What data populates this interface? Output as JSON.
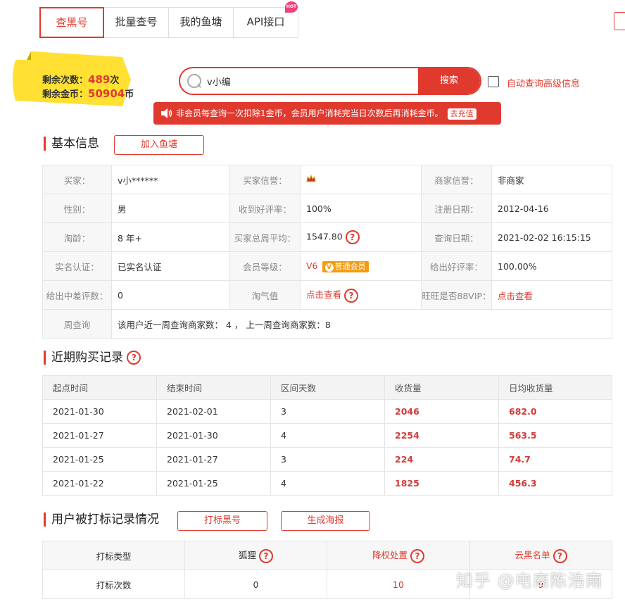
{
  "tabs": [
    {
      "label": "查黑号"
    },
    {
      "label": "批量查号"
    },
    {
      "label": "我的鱼塘"
    },
    {
      "label": "API接口",
      "badge": "HOT"
    }
  ],
  "balance": {
    "times_label": "剩余次数：",
    "times_value": "489",
    "times_unit": "次",
    "coins_label": "剩余金币：",
    "coins_value": "50904",
    "coins_unit": "币"
  },
  "search": {
    "value": "v小编",
    "button": "搜索",
    "advanced_label": "自动查询高级信息"
  },
  "notice": {
    "text": "非会员每查询一次扣除1金币，会员用户消耗完当日次数后再消耗金币。",
    "link": "去充值"
  },
  "basic": {
    "title": "基本信息",
    "add_button": "加入鱼塘",
    "rows": [
      {
        "l1": "买家：",
        "v1": "v小******",
        "l2": "买家信誉：",
        "v2": "crown-icon",
        "l3": "商家信誉：",
        "v3": "非商家"
      },
      {
        "l1": "性别：",
        "v1": "男",
        "l2": "收到好评率：",
        "v2": "100%",
        "l3": "注册日期：",
        "v3": "2012-04-16"
      },
      {
        "l1": "淘龄：",
        "v1": "8 年+",
        "l2": "买家总周平均：",
        "v2": "1547.80",
        "l3": "查询日期：",
        "v3": "2021-02-02 16:15:15"
      },
      {
        "l1": "实名认证：",
        "v1": "已实名认证",
        "l2": "会员等级：",
        "v2": "V6",
        "v2_badge": "普通会员",
        "l3": "给出好评率：",
        "v3": "100.00%"
      },
      {
        "l1": "给出中差评数：",
        "v1": "0",
        "l2": "淘气值",
        "v2": "点击查看",
        "l3": "旺旺是否88VIP：",
        "v3": "点击查看"
      }
    ],
    "weekly_label": "周查询",
    "weekly_text": "该用户近一周查询商家数： 4 ， 上一周查询商家数：8"
  },
  "records": {
    "title": "近期购买记录",
    "headers": [
      "起点时间",
      "结束时间",
      "区间天数",
      "收货量",
      "日均收货量"
    ],
    "rows": [
      [
        "2021-01-30",
        "2021-02-01",
        "3",
        "2046",
        "682.0"
      ],
      [
        "2021-01-27",
        "2021-01-30",
        "4",
        "2254",
        "563.5"
      ],
      [
        "2021-01-25",
        "2021-01-27",
        "3",
        "224",
        "74.7"
      ],
      [
        "2021-01-22",
        "2021-01-25",
        "4",
        "1825",
        "456.3"
      ]
    ]
  },
  "marks": {
    "title": "用户被打标记录情况",
    "btn1": "打标黑号",
    "btn2": "生成海报",
    "headers": [
      "打标类型",
      "狐狸",
      "降权处置",
      "云黑名单"
    ],
    "label": "打标次数",
    "values": [
      "0",
      "10",
      "9"
    ]
  },
  "watermark": "知乎 @电商陈浩南",
  "colors": {
    "accent": "#e03a2f",
    "ribbon": "#ffe033"
  }
}
